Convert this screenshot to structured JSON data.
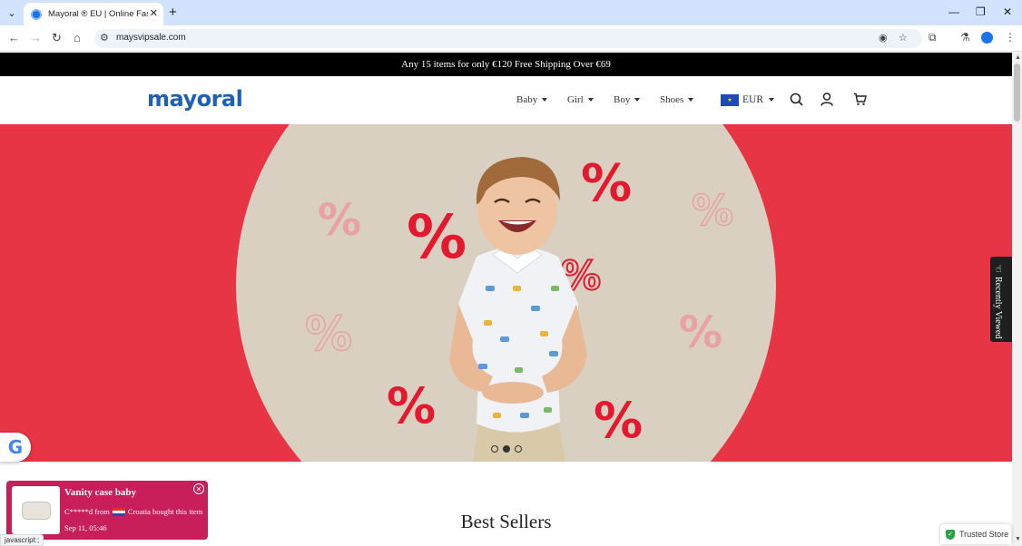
{
  "browser": {
    "tab_title": "Mayoral ® EU | Online Fashion",
    "url": "maysvipsale.com",
    "status_text": "javascript:;"
  },
  "announcement": "Any 15 items for only €120 Free Shipping Over €69",
  "header": {
    "logo": "mayoral",
    "menu": [
      {
        "label": "Baby"
      },
      {
        "label": "Girl"
      },
      {
        "label": "Boy"
      },
      {
        "label": "Shoes"
      }
    ],
    "currency": "EUR"
  },
  "hero": {
    "slide_count": 3,
    "active_slide": 2,
    "background_color": "#e83545",
    "circle_color": "#d9d0c2"
  },
  "recently_viewed": "Recently Viewed",
  "section_title": "Best Sellers",
  "popup": {
    "product_name": "Vanity case baby",
    "buyer_name": "C*****d from",
    "buyer_country": "Croatia bought this item",
    "time": "Sep 11, 05:46"
  },
  "trusted_store": "Trusted Store"
}
